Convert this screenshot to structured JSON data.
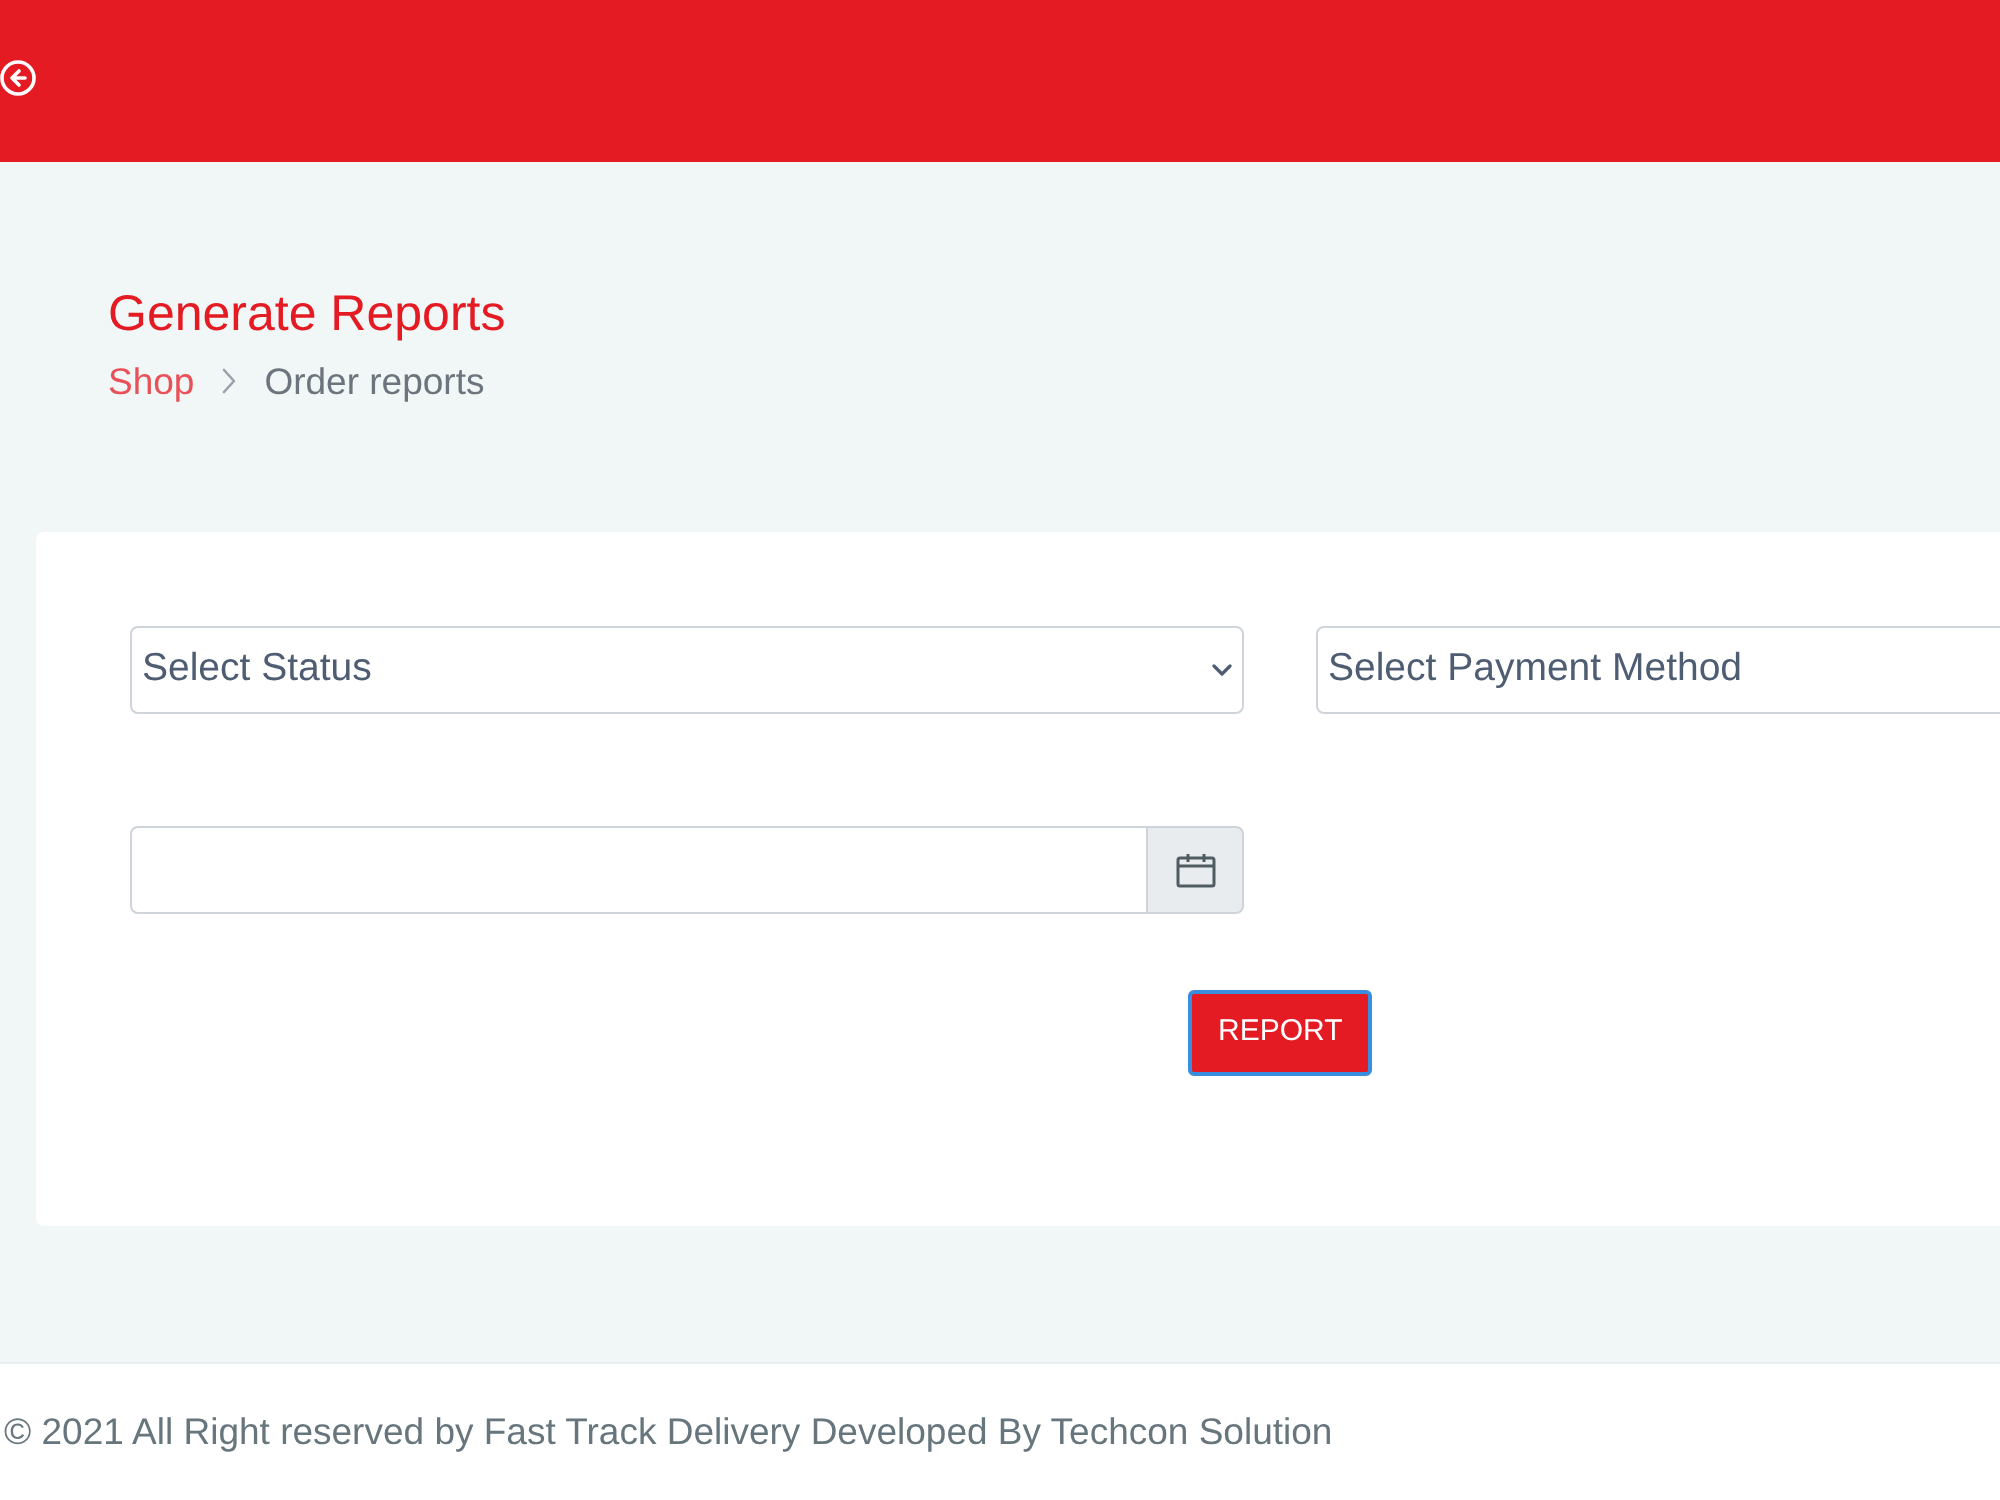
{
  "header": {
    "back_button": {
      "kind": "icon"
    }
  },
  "page_title": "Generate Reports",
  "breadcrumb": [
    {
      "label": "Shop",
      "active": false
    },
    {
      "label": "Order reports",
      "active": true
    }
  ],
  "form": {
    "status_select": {
      "value": "Select Status"
    },
    "payment_select": {
      "value": "Select Payment Method"
    },
    "report_button": {
      "label": "REPORT",
      "focused": true
    }
  },
  "footer": {
    "text": "© 2021 All Right reserved by Fast Track Delivery Developed By Techcon Solution"
  }
}
